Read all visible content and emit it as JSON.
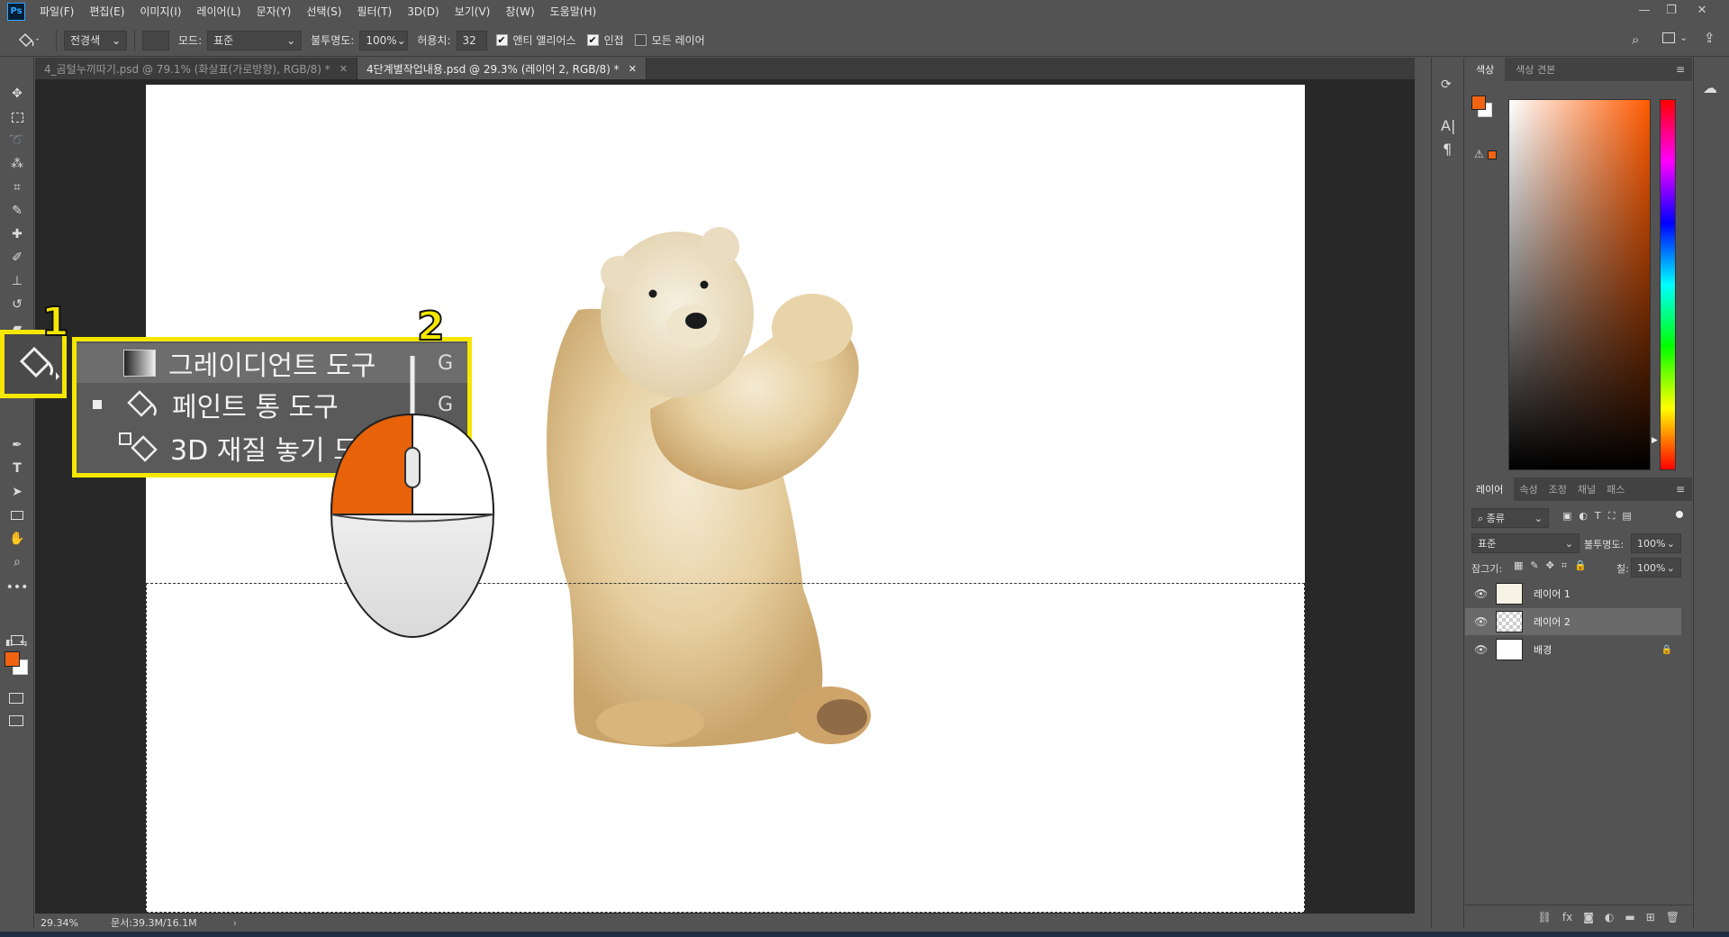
{
  "app": {
    "logo": "Ps"
  },
  "menubar": {
    "items": [
      "파일(F)",
      "편집(E)",
      "이미지(I)",
      "레이어(L)",
      "문자(Y)",
      "선택(S)",
      "필터(T)",
      "3D(D)",
      "보기(V)",
      "창(W)",
      "도움말(H)"
    ],
    "window_controls": [
      "minimize-icon",
      "restore-icon",
      "close-icon"
    ]
  },
  "options": {
    "fill_source": "전경색",
    "mode_label": "모드:",
    "mode_value": "표준",
    "opacity_label": "불투명도:",
    "opacity_value": "100%",
    "tolerance_label": "허용치:",
    "tolerance_value": "32",
    "antialias_label": "앤티 앨리어스",
    "antialias_checked": true,
    "contiguous_label": "인접",
    "contiguous_checked": true,
    "all_layers_label": "모든 레이어",
    "all_layers_checked": false
  },
  "tabs": [
    {
      "label": "4_곰털누끼따기.psd @ 79.1% (화살표(가로방향), RGB/8) *",
      "active": false
    },
    {
      "label": "4단계별작업내용.psd @ 29.3% (레이어 2, RGB/8) *",
      "active": true
    }
  ],
  "status": {
    "zoom": "29.34%",
    "doc": "문서:39.3M/16.1M",
    "arrow": "›"
  },
  "flyout": {
    "items": [
      {
        "label": "그레이디언트 도구",
        "key": "G",
        "icon": "gradient-icon",
        "current": false
      },
      {
        "label": "페인트 통 도구",
        "key": "G",
        "icon": "paint-bucket-icon",
        "current": true
      },
      {
        "label": "3D 재질 놓기 도구",
        "key": "G",
        "icon": "3d-material-drop-icon",
        "current": false
      }
    ]
  },
  "callouts": {
    "one": "1",
    "two": "2"
  },
  "colors": {
    "foreground": "#f06411",
    "background": "#ffffff",
    "highlight": "#f5e700",
    "mouse_button": "#e8620a"
  },
  "color_panel": {
    "tabs": [
      "색상",
      "색상 견본"
    ]
  },
  "layers_panel": {
    "tabs": [
      "레이어",
      "속성",
      "조정",
      "채널",
      "패스"
    ],
    "filter_label": "종류",
    "blend_mode": "표준",
    "opacity_label": "불투명도:",
    "opacity_value": "100%",
    "lock_label": "잠그기:",
    "fill_label": "칠:",
    "fill_value": "100%",
    "layers": [
      {
        "name": "레이어 1",
        "selected": false,
        "locked": false
      },
      {
        "name": "레이어 2",
        "selected": true,
        "locked": false
      },
      {
        "name": "배경",
        "selected": false,
        "locked": true
      }
    ]
  }
}
